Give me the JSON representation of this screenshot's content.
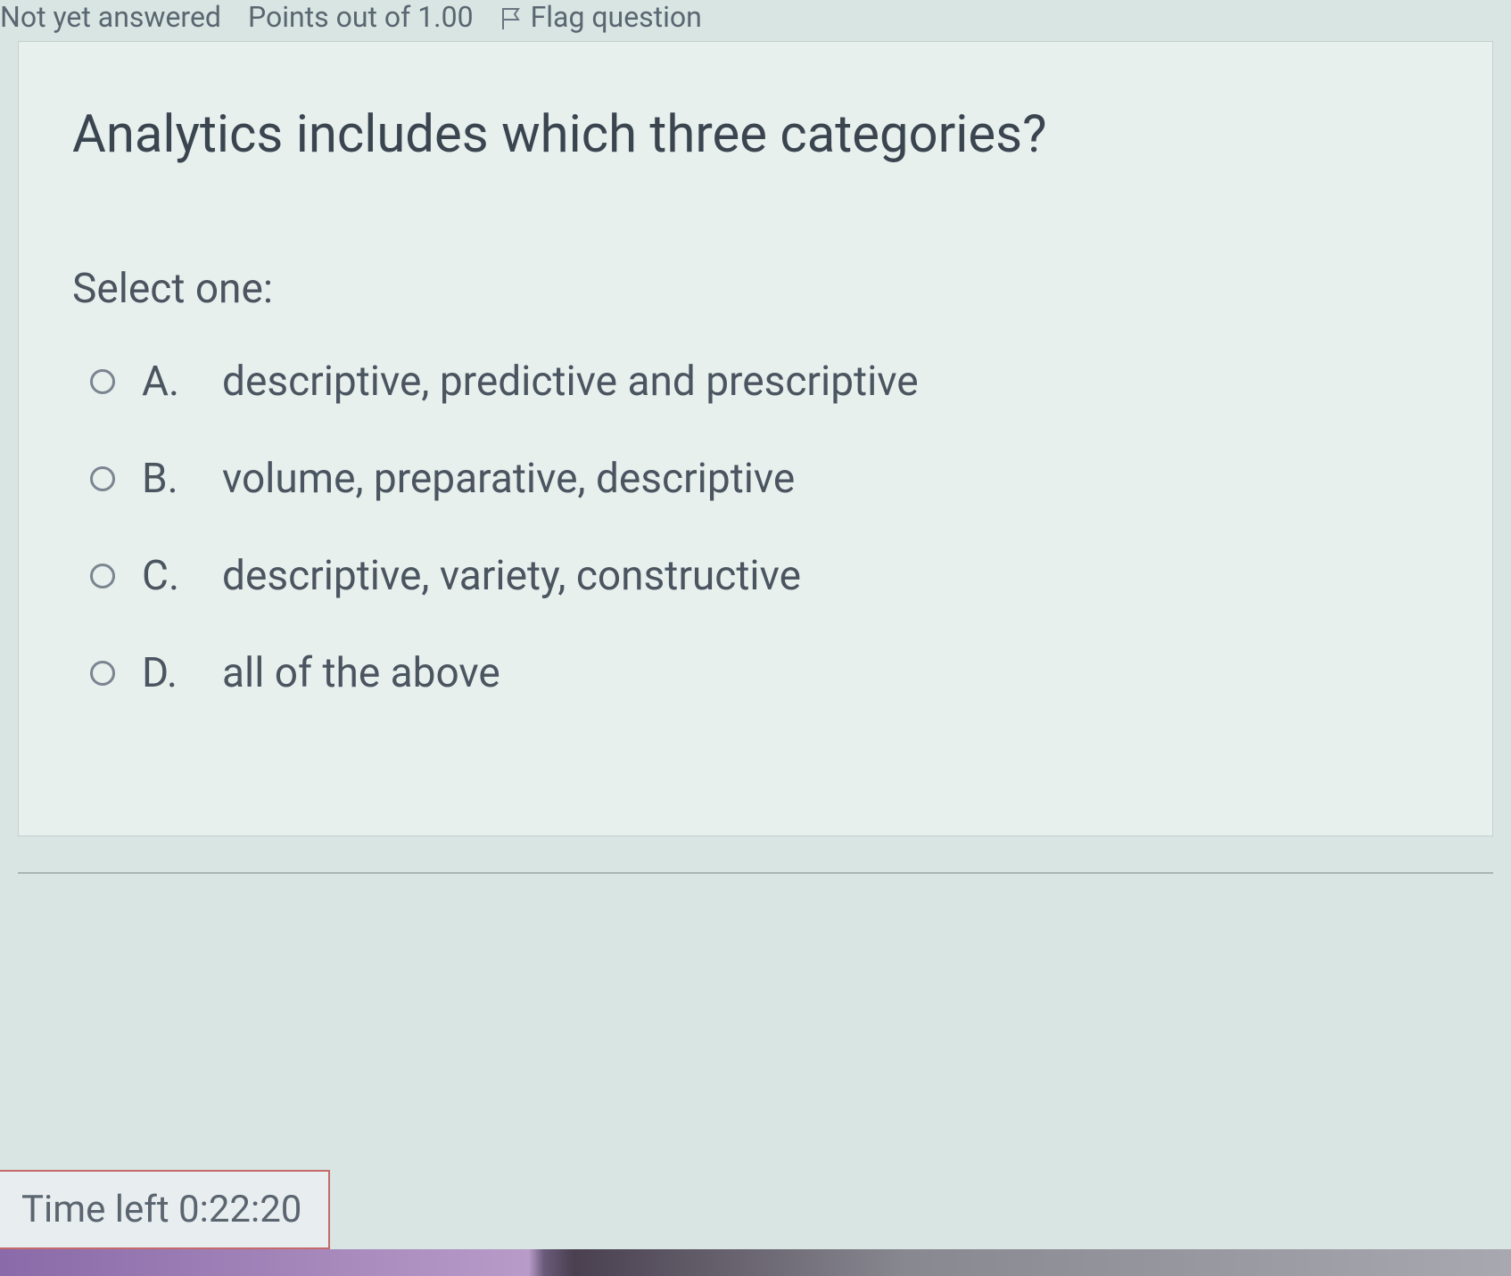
{
  "meta": {
    "status": "Not yet answered",
    "points": "Points out of 1.00",
    "flag": "Flag question"
  },
  "question": {
    "title": "Analytics includes which three categories?",
    "select_label": "Select one:",
    "options": [
      {
        "letter": "A.",
        "text": "descriptive, predictive and prescriptive"
      },
      {
        "letter": "B.",
        "text": "volume, preparative, descriptive"
      },
      {
        "letter": "C.",
        "text": "descriptive, variety, constructive"
      },
      {
        "letter": "D.",
        "text": "all of the above"
      }
    ]
  },
  "timer": {
    "label": "Time left 0:22:20"
  }
}
